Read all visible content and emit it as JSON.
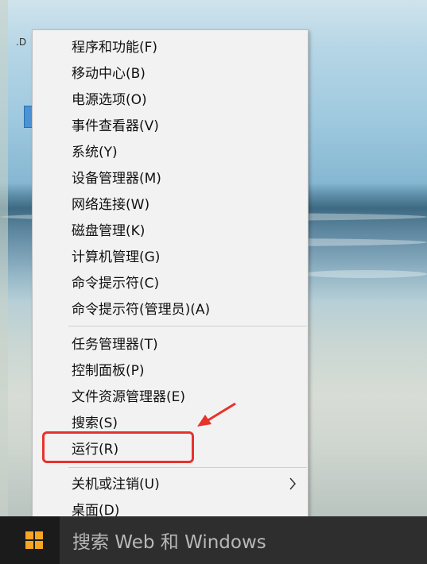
{
  "desktop": {
    "icon_label": ".D"
  },
  "menu": {
    "groups": [
      [
        {
          "label": "程序和功能(F)"
        },
        {
          "label": "移动中心(B)"
        },
        {
          "label": "电源选项(O)"
        },
        {
          "label": "事件查看器(V)"
        },
        {
          "label": "系统(Y)"
        },
        {
          "label": "设备管理器(M)"
        },
        {
          "label": "网络连接(W)"
        },
        {
          "label": "磁盘管理(K)"
        },
        {
          "label": "计算机管理(G)"
        },
        {
          "label": "命令提示符(C)"
        },
        {
          "label": "命令提示符(管理员)(A)"
        }
      ],
      [
        {
          "label": "任务管理器(T)"
        },
        {
          "label": "控制面板(P)"
        },
        {
          "label": "文件资源管理器(E)"
        },
        {
          "label": "搜索(S)"
        },
        {
          "label": "运行(R)"
        }
      ],
      [
        {
          "label": "关机或注销(U)",
          "submenu_icon": "chevron-right-icon"
        },
        {
          "label": "桌面(D)"
        }
      ]
    ]
  },
  "taskbar": {
    "start_icon": "windows-logo-icon",
    "search_text": "搜索 Web 和 Windows"
  },
  "annotation": {
    "highlighted_item": "运行(R)",
    "color": "#e8322c"
  },
  "colors": {
    "menu_bg": "#f2f2f2",
    "taskbar_bg": "#1b1b1b",
    "windows_logo": "#f6a623"
  }
}
